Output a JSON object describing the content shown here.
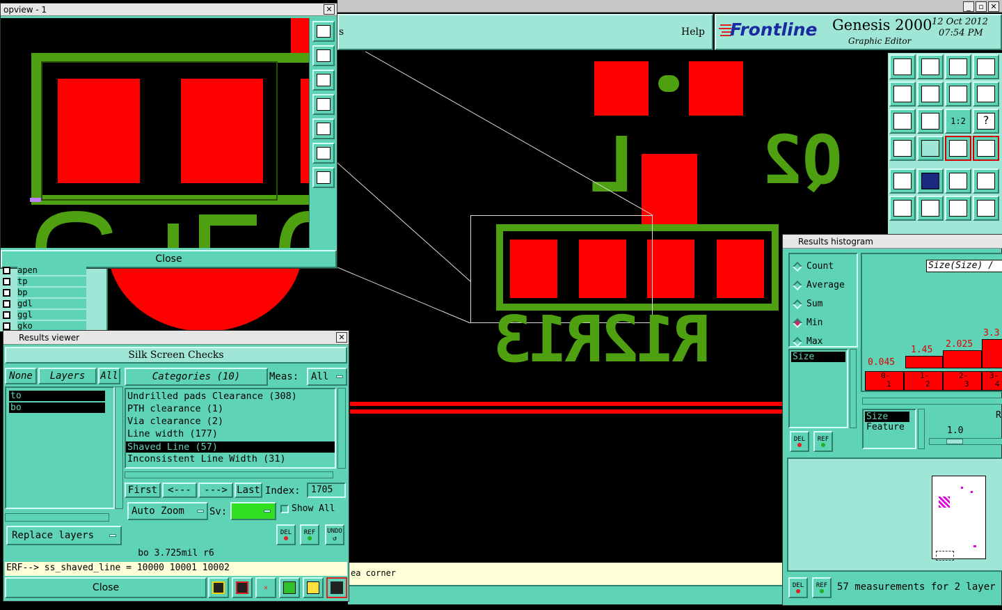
{
  "main_toolbar": {
    "partial_label": "s",
    "help_label": "Help"
  },
  "brand": {
    "logo": "Frontline",
    "product": "Genesis 2000",
    "subtitle": "Graphic Editor",
    "date": "12 Oct 2012",
    "time": "07:54 PM"
  },
  "canvas": {
    "ref1": "Q2",
    "ref2": "L",
    "ref3": "R12R13",
    "status_text": "ea corner"
  },
  "topview": {
    "title": "opview - 1",
    "close_label": "Close"
  },
  "layers_panel": {
    "items": [
      "apen",
      "tp",
      "bp",
      "gdl",
      "ggl",
      "gko"
    ]
  },
  "results_viewer": {
    "title": "Results viewer",
    "header": "Silk Screen Checks",
    "none_label": "None",
    "layers_label": "Layers",
    "all_label": "All",
    "categories_label": "Categories (10)",
    "meas_label": "Meas:",
    "meas_value": "All",
    "layers": [
      "to",
      "bo"
    ],
    "categories": [
      "Undrilled pads Clearance (308)",
      "PTH clearance (1)",
      "Via clearance (2)",
      "Line width (177)",
      "Shaved Line (57)",
      "Inconsistent Line Width (31)"
    ],
    "selected_category": "Shaved Line (57)",
    "first_label": "First",
    "prev_label": "<---",
    "next_label": "--->",
    "last_label": "Last",
    "index_label": "Index:",
    "index_value": "1705",
    "auto_zoom_label": "Auto Zoom",
    "sv_label": "Sv:",
    "show_all_label": "Show All",
    "replace_layers_label": "Replace layers",
    "del_label": "DEL",
    "ref_label": "REF",
    "undo_label": "UNDO",
    "status_line": "bo 3.725mil  r6",
    "erf_line": "ERF--> ss_shaved_line = 10000 10001 10002",
    "close_label": "Close"
  },
  "histogram": {
    "title": "Results histogram",
    "options": [
      "Count",
      "Average",
      "Sum",
      "Min",
      "Max"
    ],
    "selected_option": "Min",
    "field_label": "Size(Size) /",
    "list_item": "Size",
    "del_label": "DEL",
    "ref_label": "REF",
    "bar_values": [
      "0.045",
      "1.45",
      "2.025",
      "3.3"
    ],
    "bins": [
      [
        "0-",
        "1"
      ],
      [
        "1-",
        "2"
      ],
      [
        "2-",
        "3"
      ],
      [
        "3-",
        "4"
      ]
    ],
    "list2": [
      "Size",
      "Feature"
    ],
    "scale_label": "R",
    "scale_value": "1.0",
    "footer": "57 measurements for 2 layer"
  }
}
